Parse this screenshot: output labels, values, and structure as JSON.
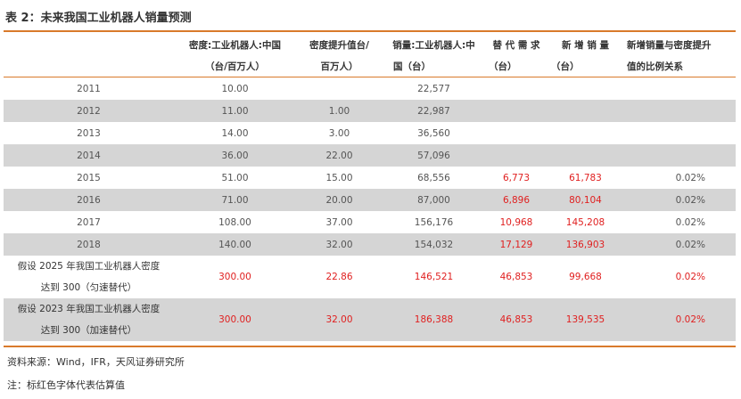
{
  "title": "表 2：未来我国工业机器人销量预测",
  "columns": [
    [
      "",
      ""
    ],
    [
      "密度:工业机器人:中国",
      "（台/百万人）"
    ],
    [
      "密度提升值台/",
      "百万人）"
    ],
    [
      "销量:工业机器人:中",
      "国（台）"
    ],
    [
      "替 代 需 求",
      "（台）"
    ],
    [
      "新 增 销 量",
      "（台）"
    ],
    [
      "新增销量与密度提升",
      "值的比例关系"
    ]
  ],
  "rows": [
    {
      "year": "2011",
      "density": "10.00",
      "increase": "",
      "sales": "22,577",
      "replace": "",
      "new_sales": "",
      "ratio": ""
    },
    {
      "year": "2012",
      "density": "11.00",
      "increase": "1.00",
      "sales": "22,987",
      "replace": "",
      "new_sales": "",
      "ratio": ""
    },
    {
      "year": "2013",
      "density": "14.00",
      "increase": "3.00",
      "sales": "36,560",
      "replace": "",
      "new_sales": "",
      "ratio": ""
    },
    {
      "year": "2014",
      "density": "36.00",
      "increase": "22.00",
      "sales": "57,096",
      "replace": "",
      "new_sales": "",
      "ratio": ""
    },
    {
      "year": "2015",
      "density": "51.00",
      "increase": "15.00",
      "sales": "68,556",
      "replace": "6,773",
      "new_sales": "61,783",
      "ratio": "0.02%"
    },
    {
      "year": "2016",
      "density": "71.00",
      "increase": "20.00",
      "sales": "87,000",
      "replace": "6,896",
      "new_sales": "80,104",
      "ratio": "0.02%"
    },
    {
      "year": "2017",
      "density": "108.00",
      "increase": "37.00",
      "sales": "156,176",
      "replace": "10,968",
      "new_sales": "145,208",
      "ratio": "0.02%"
    },
    {
      "year": "2018",
      "density": "140.00",
      "increase": "32.00",
      "sales": "154,032",
      "replace": "17,129",
      "new_sales": "136,903",
      "ratio": "0.02%"
    }
  ],
  "scenarios": [
    {
      "line1": "假设 2025 年我国工业机器人密度",
      "line2": "达到 300（匀速替代）",
      "density": "300.00",
      "increase": "22.86",
      "sales": "146,521",
      "replace": "46,853",
      "new_sales": "99,668",
      "ratio": "0.02%"
    },
    {
      "line1": "假设 2023 年我国工业机器人密度",
      "line2": "达到 300（加速替代）",
      "density": "300.00",
      "increase": "32.00",
      "sales": "186,388",
      "replace": "46,853",
      "new_sales": "139,535",
      "ratio": "0.02%"
    }
  ],
  "source": "资料来源：Wind，IFR，天风证券研究所",
  "note": "注：标红色字体代表估算值"
}
